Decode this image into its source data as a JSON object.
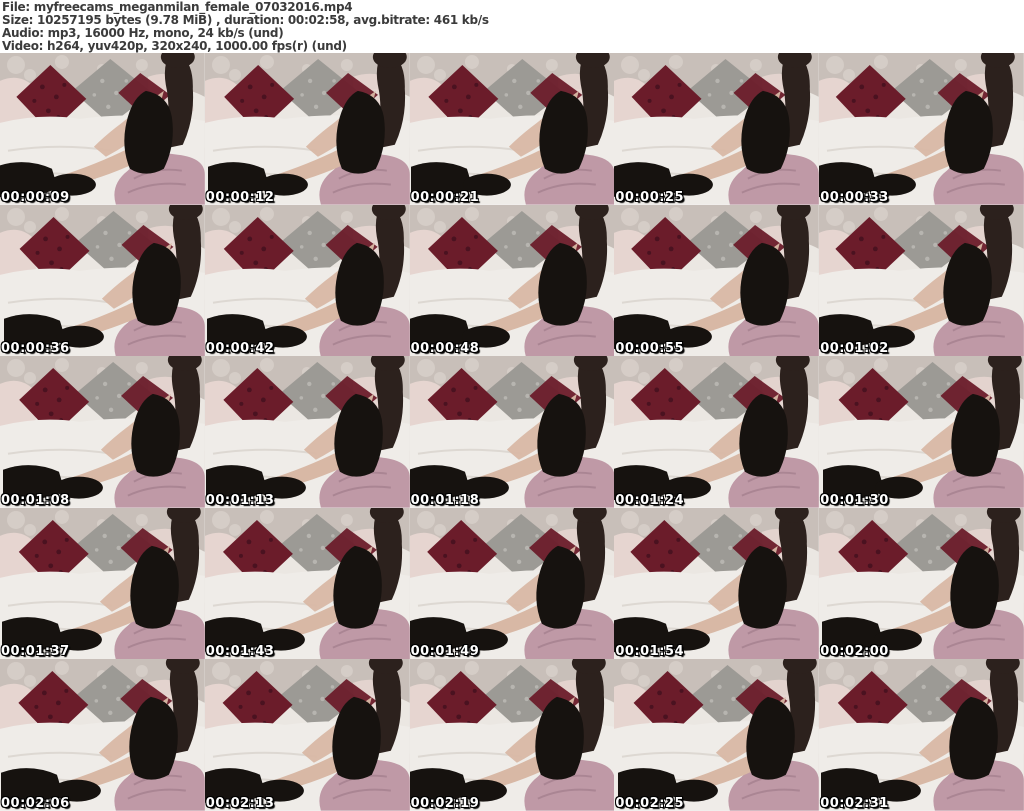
{
  "header": {
    "file_line": "File: myfreecams_meganmilan_female_07032016.mp4",
    "size_line": "Size: 10257195 bytes (9.78 MiB) , duration: 00:02:58, avg.bitrate: 461 kb/s",
    "audio_line": "Audio: mp3, 16000 Hz, mono, 24 kb/s (und)",
    "video_line": "Video: h264, yuv420p, 320x240, 1000.00 fps(r) (und)"
  },
  "grid": {
    "columns": 5,
    "rows": 5,
    "thumbnails": [
      {
        "timestamp": "00:00:09"
      },
      {
        "timestamp": "00:00:12"
      },
      {
        "timestamp": "00:00:21"
      },
      {
        "timestamp": "00:00:25"
      },
      {
        "timestamp": "00:00:33"
      },
      {
        "timestamp": "00:00:36"
      },
      {
        "timestamp": "00:00:42"
      },
      {
        "timestamp": "00:00:48"
      },
      {
        "timestamp": "00:00:55"
      },
      {
        "timestamp": "00:01:02"
      },
      {
        "timestamp": "00:01:08"
      },
      {
        "timestamp": "00:01:13"
      },
      {
        "timestamp": "00:01:18"
      },
      {
        "timestamp": "00:01:24"
      },
      {
        "timestamp": "00:01:30"
      },
      {
        "timestamp": "00:01:37"
      },
      {
        "timestamp": "00:01:43"
      },
      {
        "timestamp": "00:01:49"
      },
      {
        "timestamp": "00:01:54"
      },
      {
        "timestamp": "00:02:00"
      },
      {
        "timestamp": "00:02:06"
      },
      {
        "timestamp": "00:02:13"
      },
      {
        "timestamp": "00:02:19"
      },
      {
        "timestamp": "00:02:25"
      },
      {
        "timestamp": "00:02:31"
      }
    ]
  },
  "colors": {
    "header_text": "#3b3b3b",
    "header_bg": "#ffffff",
    "wallpaper": "#c8bfb9",
    "wallpaper_pattern": "#d9d1cb",
    "bed_sheet": "#efece8",
    "bed_crease": "#ddd8d2",
    "pillow_white": "#ebe7e2",
    "pillow_pale_pink": "#e6d5d0",
    "pillow_maroon": "#6b1c2a",
    "pillow_maroon_dark": "#4a1220",
    "pillow_gray": "#9c9a95",
    "pillow_gray_light": "#b7b5b0",
    "blanket_mauve": "#bf99a6",
    "blanket_fold": "#aa8593",
    "hair_dark": "#2c211d",
    "clothing_black": "#16120f",
    "skin_tone": "#d8b8a5",
    "timestamp_text": "#ffffff",
    "timestamp_outline": "#000000"
  }
}
